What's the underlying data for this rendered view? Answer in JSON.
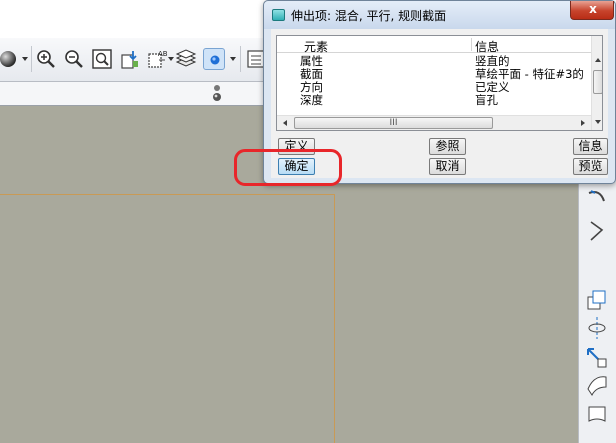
{
  "app": {
    "toolbar_icons": [
      "shade-sphere-icon",
      "zoom-in-icon",
      "zoom-out-icon",
      "refit-icon",
      "reorient-icon",
      "named-views-icon",
      "layers-icon",
      "spin-center-icon",
      "model-tree-icon"
    ],
    "subbar_icons": [
      "datum-display-icon"
    ],
    "right_tool_icons": [
      "revolve-icon",
      "sweep-icon",
      "blend-icon",
      "copy-feature-icon",
      "mirror-icon",
      "move-icon",
      "surface-icon",
      "fill-surface-icon"
    ]
  },
  "dialog": {
    "title": "伸出项: 混合, 平行, 规则截面",
    "icon": "feature-dialog-icon",
    "close_label": "x",
    "columns": [
      "元素",
      "信息"
    ],
    "rows": [
      {
        "element": "属性",
        "info": "竖直的"
      },
      {
        "element": "截面",
        "info": "草绘平面 - 特征#3的"
      },
      {
        "element": "方向",
        "info": "已定义"
      },
      {
        "element": "深度",
        "info": "盲孔"
      }
    ],
    "hscroll_grip": "III",
    "buttons": {
      "define": "定义",
      "refs": "参照",
      "info": "信息",
      "ok": "确定",
      "cancel": "取消",
      "preview": "预览"
    }
  },
  "colors": {
    "viewport_bg": "#a9a99c",
    "highlight": "#e8262a",
    "sketch_edge": "#c99a55"
  }
}
